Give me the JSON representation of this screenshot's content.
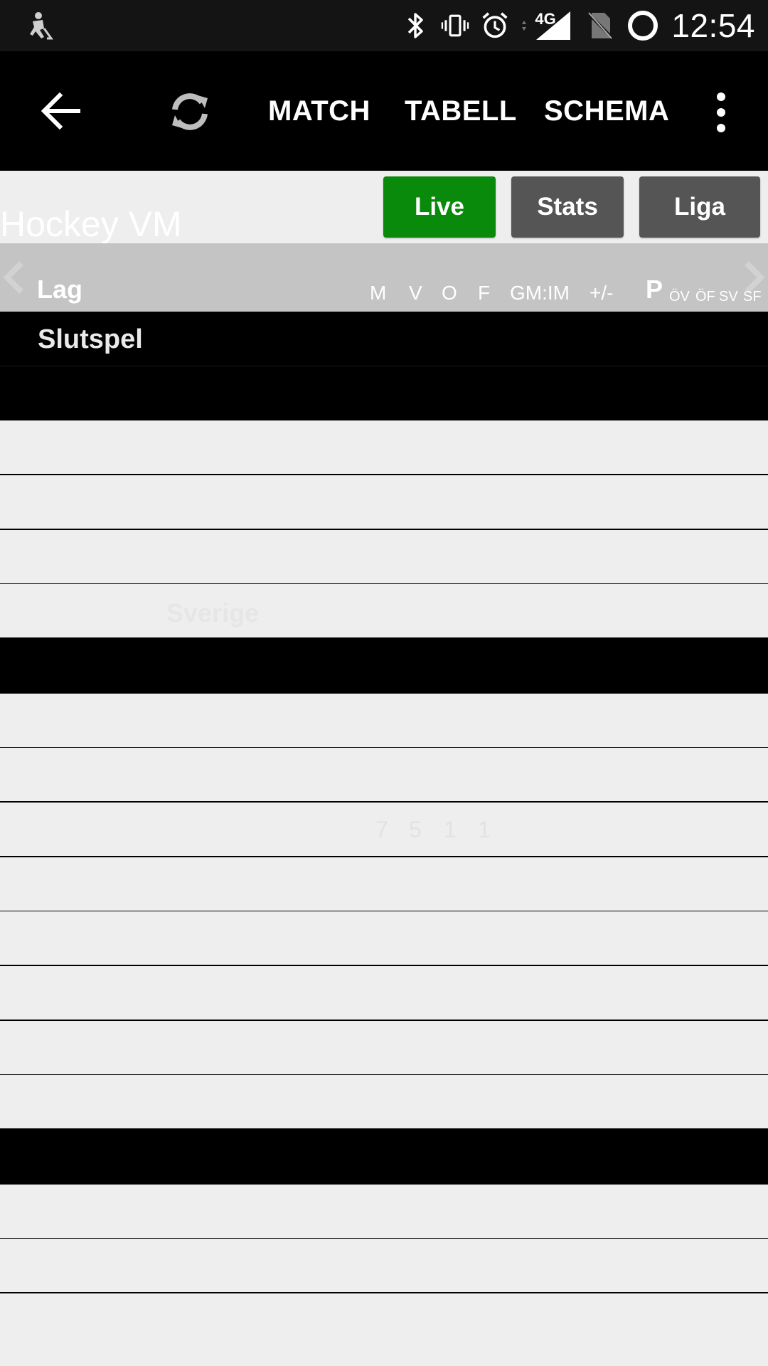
{
  "status_bar": {
    "left_icon": "hockey-player-icon",
    "icons": [
      "bluetooth-icon",
      "vibrate-icon",
      "alarm-icon",
      "signal-4g-icon",
      "no-sim-icon",
      "loading-ring-icon"
    ],
    "network_label": "4G",
    "time": "12:54"
  },
  "app_bar": {
    "back_icon": "arrow-left-icon",
    "refresh_icon": "refresh-icon",
    "tabs": [
      {
        "label": "MATCH"
      },
      {
        "label": "TABELL"
      },
      {
        "label": "SCHEMA"
      }
    ],
    "overflow_icon": "more-vert-icon"
  },
  "sub_header": {
    "title": "Hockey VM",
    "buttons": [
      {
        "label": "Live",
        "color": "#0a8a0a"
      },
      {
        "label": "Stats",
        "color": "#555555"
      },
      {
        "label": "Liga",
        "color": "#555555"
      }
    ]
  },
  "table": {
    "header": {
      "team": "Lag",
      "columns": [
        "M",
        "V",
        "O",
        "F",
        "GM:IM",
        "+/-"
      ],
      "points": "P",
      "extra_columns": [
        "ÖV",
        "ÖF",
        "SV",
        "SF"
      ]
    },
    "section_title": "Slutspel",
    "faint_rows": [
      {
        "team": "Sverige"
      },
      {
        "values": [
          "7",
          "5",
          "1",
          "1"
        ]
      }
    ]
  },
  "colors": {
    "app_bar_bg": "#000000",
    "status_bar_bg": "#141414",
    "page_bg": "#eeeeee",
    "header_bg": "#c4c4c4",
    "live_green": "#0a8a0a"
  }
}
